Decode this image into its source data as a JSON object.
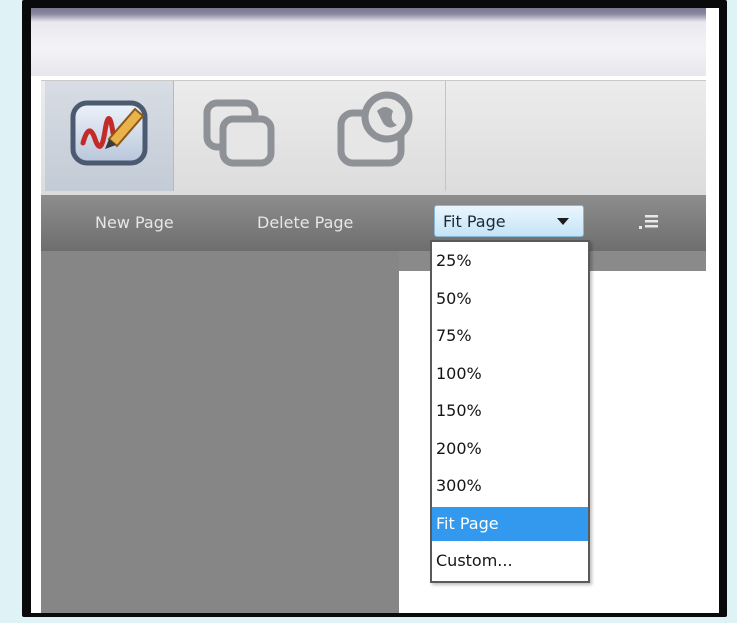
{
  "ribbon": {
    "tools": [
      {
        "icon": "pen-drawing-icon"
      },
      {
        "icon": "layers-icon"
      },
      {
        "icon": "globe-shape-icon"
      }
    ]
  },
  "toolbar": {
    "new_page_label": "New Page",
    "delete_page_label": "Delete Page",
    "zoom_value": "Fit Page",
    "menu_icon": "list-icon"
  },
  "zoom_menu": {
    "options": [
      "25%",
      "50%",
      "75%",
      "100%",
      "150%",
      "200%",
      "300%",
      "Fit Page",
      "Custom..."
    ],
    "selected_index": 7
  },
  "colors": {
    "accent": "#3399ee",
    "toolbar": "#7a7a7a",
    "canvas": "#868686"
  }
}
